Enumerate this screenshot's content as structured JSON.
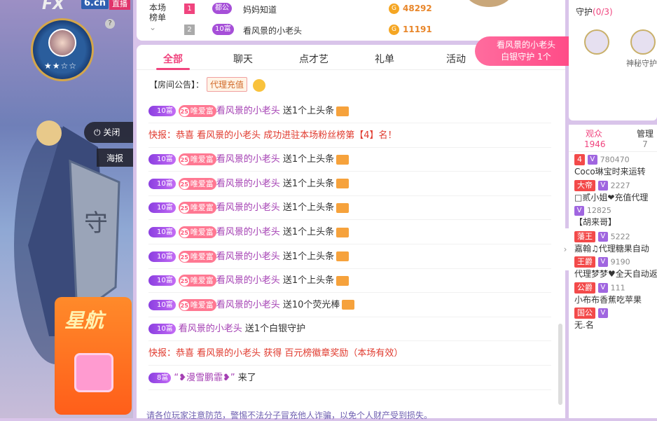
{
  "brand": {
    "logo": "FX",
    "site": "6.cn",
    "live": "直播"
  },
  "anchor": {
    "stars": "★★☆☆",
    "help": "?"
  },
  "side_buttons": {
    "close": "关闭",
    "poster": "海报"
  },
  "promo": {
    "title": "星航"
  },
  "rank": {
    "label": "本场榜单",
    "rows": [
      {
        "no": "1",
        "color": "#f0447e",
        "badge": "都公",
        "name": "妈妈知道",
        "coin": "G",
        "value": "48292"
      },
      {
        "no": "2",
        "color": "#aaa",
        "badge": "10富",
        "name": "看风景的小老头",
        "coin": "G",
        "value": "11191"
      }
    ]
  },
  "tabs": [
    "全部",
    "聊天",
    "点才艺",
    "礼单",
    "活动"
  ],
  "notice": {
    "label": "【房间公告】：",
    "tag": "代理充值"
  },
  "messages": [
    {
      "type": "gift",
      "lv": "10富",
      "fan": "唯爱富",
      "fanlv": "25",
      "user": "看风景的小老头",
      "text": "送1个上头条"
    },
    {
      "type": "flash",
      "text": "快报：恭喜 看风景的小老头 成功进驻本场粉丝榜第【4】名！"
    },
    {
      "type": "gift",
      "lv": "10富",
      "fan": "唯爱富",
      "fanlv": "25",
      "user": "看风景的小老头",
      "text": "送1个上头条"
    },
    {
      "type": "gift",
      "lv": "10富",
      "fan": "唯爱富",
      "fanlv": "25",
      "user": "看风景的小老头",
      "text": "送1个上头条"
    },
    {
      "type": "gift",
      "lv": "10富",
      "fan": "唯爱富",
      "fanlv": "25",
      "user": "看风景的小老头",
      "text": "送1个上头条"
    },
    {
      "type": "gift",
      "lv": "10富",
      "fan": "唯爱富",
      "fanlv": "25",
      "user": "看风景的小老头",
      "text": "送1个上头条"
    },
    {
      "type": "gift",
      "lv": "10富",
      "fan": "唯爱富",
      "fanlv": "25",
      "user": "看风景的小老头",
      "text": "送1个上头条"
    },
    {
      "type": "gift",
      "lv": "10富",
      "fan": "唯爱富",
      "fanlv": "25",
      "user": "看风景的小老头",
      "text": "送1个上头条"
    },
    {
      "type": "gift",
      "lv": "10富",
      "fan": "唯爱富",
      "fanlv": "25",
      "user": "看风景的小老头",
      "text": "送10个荧光棒"
    },
    {
      "type": "plain",
      "lv": "10富",
      "user": "看风景的小老头",
      "text": "送1个白银守护"
    },
    {
      "type": "flash",
      "text": "快报：恭喜 看风景的小老头 获得 百元榜徽章奖励（本场有效）"
    },
    {
      "type": "plain",
      "lv": "8富",
      "user": "“❥漫雪鹏霏❥”",
      "text": "来了"
    }
  ],
  "warning": "请各位玩家注意防范，警惕不法分子冒充他人诈骗，以免个人财产受到损失。",
  "guard_bubble": {
    "name": "看风景的小老头",
    "text": "白银守护 1个"
  },
  "guard": {
    "title": "守护",
    "count": "(0/3)",
    "mystery": "神秘守护"
  },
  "audience": {
    "tabs": [
      {
        "label": "观众",
        "count": "1946"
      },
      {
        "label": "管理",
        "count": "7"
      }
    ],
    "users": [
      {
        "badge": "4",
        "num": "780470",
        "name": "Coco琳宝时来运转"
      },
      {
        "badge": "大帝",
        "num": "2227",
        "name": "□贰小姐❤充值代理"
      },
      {
        "badge": "",
        "num": "12825",
        "name": "【胡来哥】"
      },
      {
        "badge": "藩王",
        "num": "5222",
        "name": "嘉翰♫代理糖果自动"
      },
      {
        "badge": "王爵",
        "num": "9190",
        "name": "代理梦梦♥全天自动返"
      },
      {
        "badge": "公爵",
        "num": "111",
        "name": "小布布香蕉吃苹果"
      },
      {
        "badge": "国公",
        "num": "",
        "name": "无.名"
      }
    ]
  },
  "fold": "›"
}
